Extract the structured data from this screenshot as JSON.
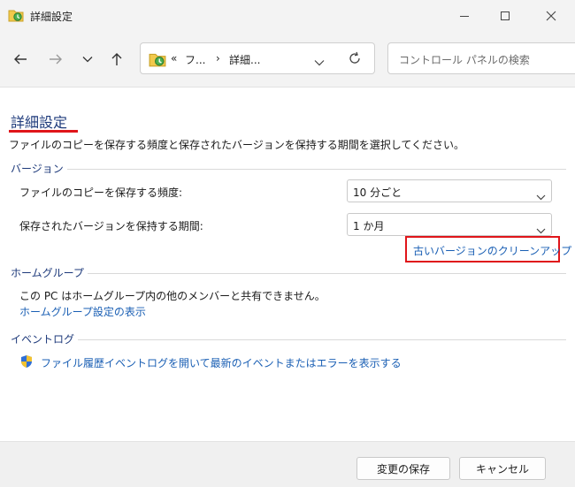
{
  "window": {
    "title": "詳細設定"
  },
  "nav": {
    "breadcrumb": {
      "overflow": "«",
      "seg1": "フ...",
      "separator": "›",
      "seg2": "詳細..."
    },
    "search_placeholder": "コントロール パネルの検索"
  },
  "page": {
    "title": "詳細設定",
    "description": "ファイルのコピーを保存する頻度と保存されたバージョンを保持する期間を選択してください。"
  },
  "versions": {
    "group_label": "バージョン",
    "frequency_label": "ファイルのコピーを保存する頻度:",
    "frequency_value": "10 分ごと",
    "retention_label": "保存されたバージョンを保持する期間:",
    "retention_value": "1 か月",
    "cleanup_link": "古いバージョンのクリーンアップ"
  },
  "homegroup": {
    "group_label": "ホームグループ",
    "message": "この PC はホームグループ内の他のメンバーと共有できません。",
    "link": "ホームグループ設定の表示"
  },
  "eventlog": {
    "group_label": "イベントログ",
    "link": "ファイル履歴イベントログを開いて最新のイベントまたはエラーを表示する"
  },
  "footer": {
    "save_label": "変更の保存",
    "cancel_label": "キャンセル"
  },
  "colors": {
    "heading": "#1e3a7b",
    "link": "#1a5fb4",
    "highlight": "#e0151a"
  }
}
